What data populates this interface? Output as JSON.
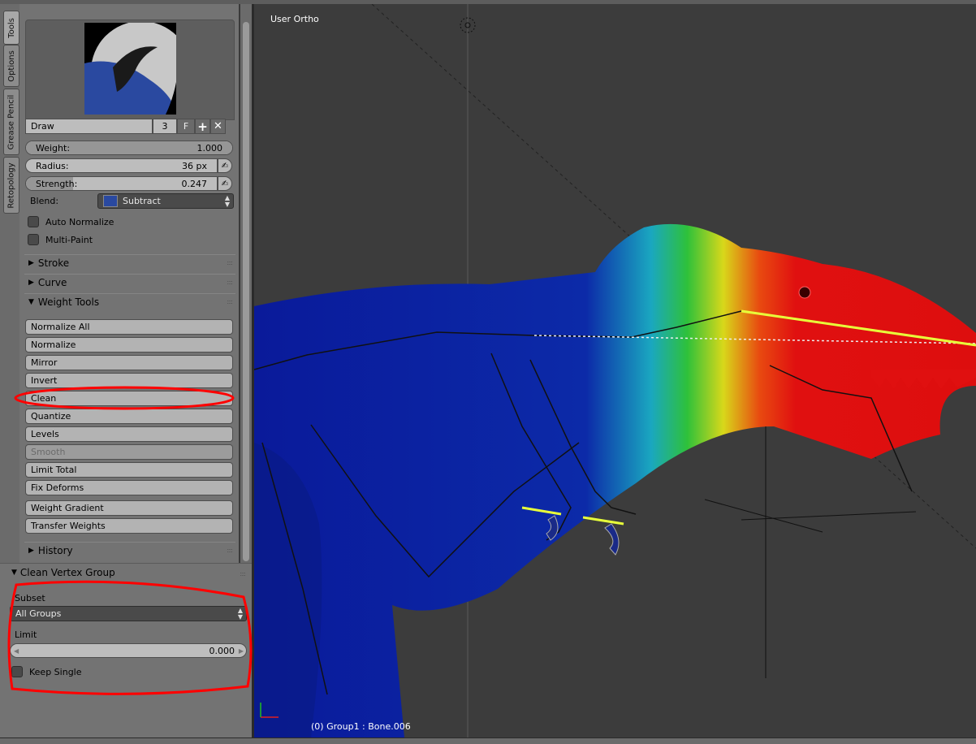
{
  "sidebar_tabs": [
    "Tools",
    "Options",
    "Grease Pencil",
    "Retopology"
  ],
  "brush": {
    "name": "Draw",
    "users": "3",
    "fake_user": "F"
  },
  "settings": {
    "weight_label": "Weight:",
    "weight_value": "1.000",
    "radius_label": "Radius:",
    "radius_value": "36 px",
    "strength_label": "Strength:",
    "strength_value": "0.247",
    "strength_fraction": 0.247,
    "blend_label": "Blend:",
    "blend_value": "Subtract",
    "auto_normalize": "Auto Normalize",
    "multi_paint": "Multi-Paint"
  },
  "sections": {
    "stroke": "Stroke",
    "curve": "Curve",
    "weight_tools": "Weight Tools",
    "history": "History"
  },
  "weight_tools": [
    "Normalize All",
    "Normalize",
    "Mirror",
    "Invert",
    "Clean",
    "Quantize",
    "Levels",
    "Smooth",
    "Limit Total",
    "Fix Deforms",
    "Weight Gradient",
    "Transfer Weights"
  ],
  "operator": {
    "title": "Clean Vertex Group",
    "subset_label": "Subset",
    "subset_value": "All Groups",
    "limit_label": "Limit",
    "limit_value": "0.000",
    "keep_single": "Keep Single"
  },
  "viewport": {
    "view_name": "User Ortho",
    "status": "(0) Group1 : Bone.006"
  },
  "colors": {
    "annotation": "#ff0000",
    "selected_bone": "#e8ff3a",
    "panel": "#737373",
    "viewport": "#3c3c3c"
  }
}
